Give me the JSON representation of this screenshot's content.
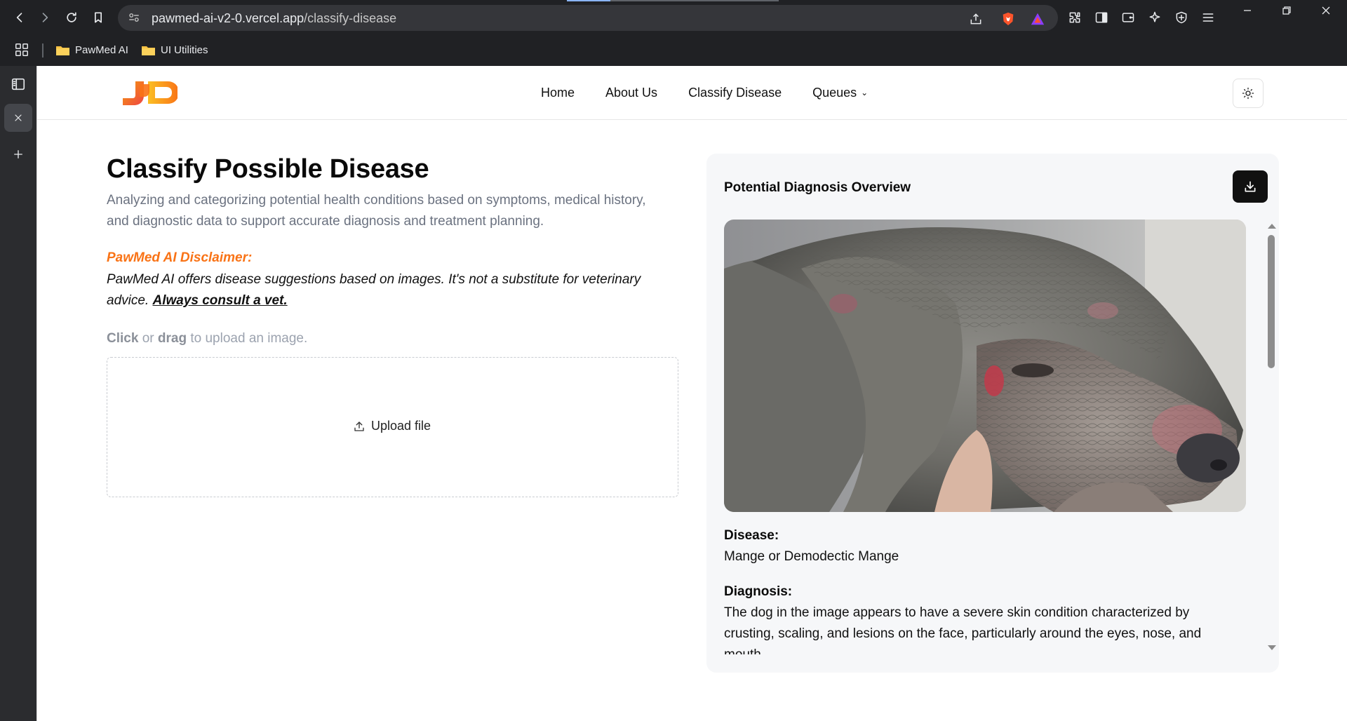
{
  "browser": {
    "url_host": "pawmed-ai-v2-0.vercel.app",
    "url_path": "/classify-disease",
    "bookmarks": [
      "PawMed AI",
      "UI Utilities"
    ]
  },
  "nav": {
    "links": [
      "Home",
      "About Us",
      "Classify Disease",
      "Queues"
    ]
  },
  "main": {
    "title": "Classify Possible Disease",
    "subtitle": "Analyzing and categorizing potential health conditions based on symptoms, medical history, and diagnostic data to support accurate diagnosis and treatment planning.",
    "disclaimer_title": "PawMed AI Disclaimer:",
    "disclaimer_text": "PawMed AI offers disease suggestions based on images. It's not a substitute for veterinary advice.",
    "disclaimer_link": "Always consult a vet.",
    "upload_hint": {
      "click": "Click",
      "or": "or",
      "drag": "drag",
      "rest": "to upload an image."
    },
    "upload_button": "Upload file"
  },
  "overview": {
    "title": "Potential Diagnosis Overview",
    "disease_label": "Disease:",
    "disease_value": "Mange or Demodectic Mange",
    "diagnosis_label": "Diagnosis:",
    "diagnosis_value": "The dog in the image appears to have a severe skin condition characterized by crusting, scaling, and lesions on the face, particularly around the eyes, nose, and mouth."
  },
  "colors": {
    "accent_orange": "#f97316",
    "chrome_bg": "#202124",
    "card_bg": "#f6f7f9"
  },
  "icons": {
    "back": "back-arrow-icon",
    "forward": "forward-arrow-icon",
    "reload": "reload-icon",
    "bookmark": "bookmark-icon",
    "theme": "sun-icon",
    "download": "download-icon",
    "upload": "upload-icon"
  }
}
